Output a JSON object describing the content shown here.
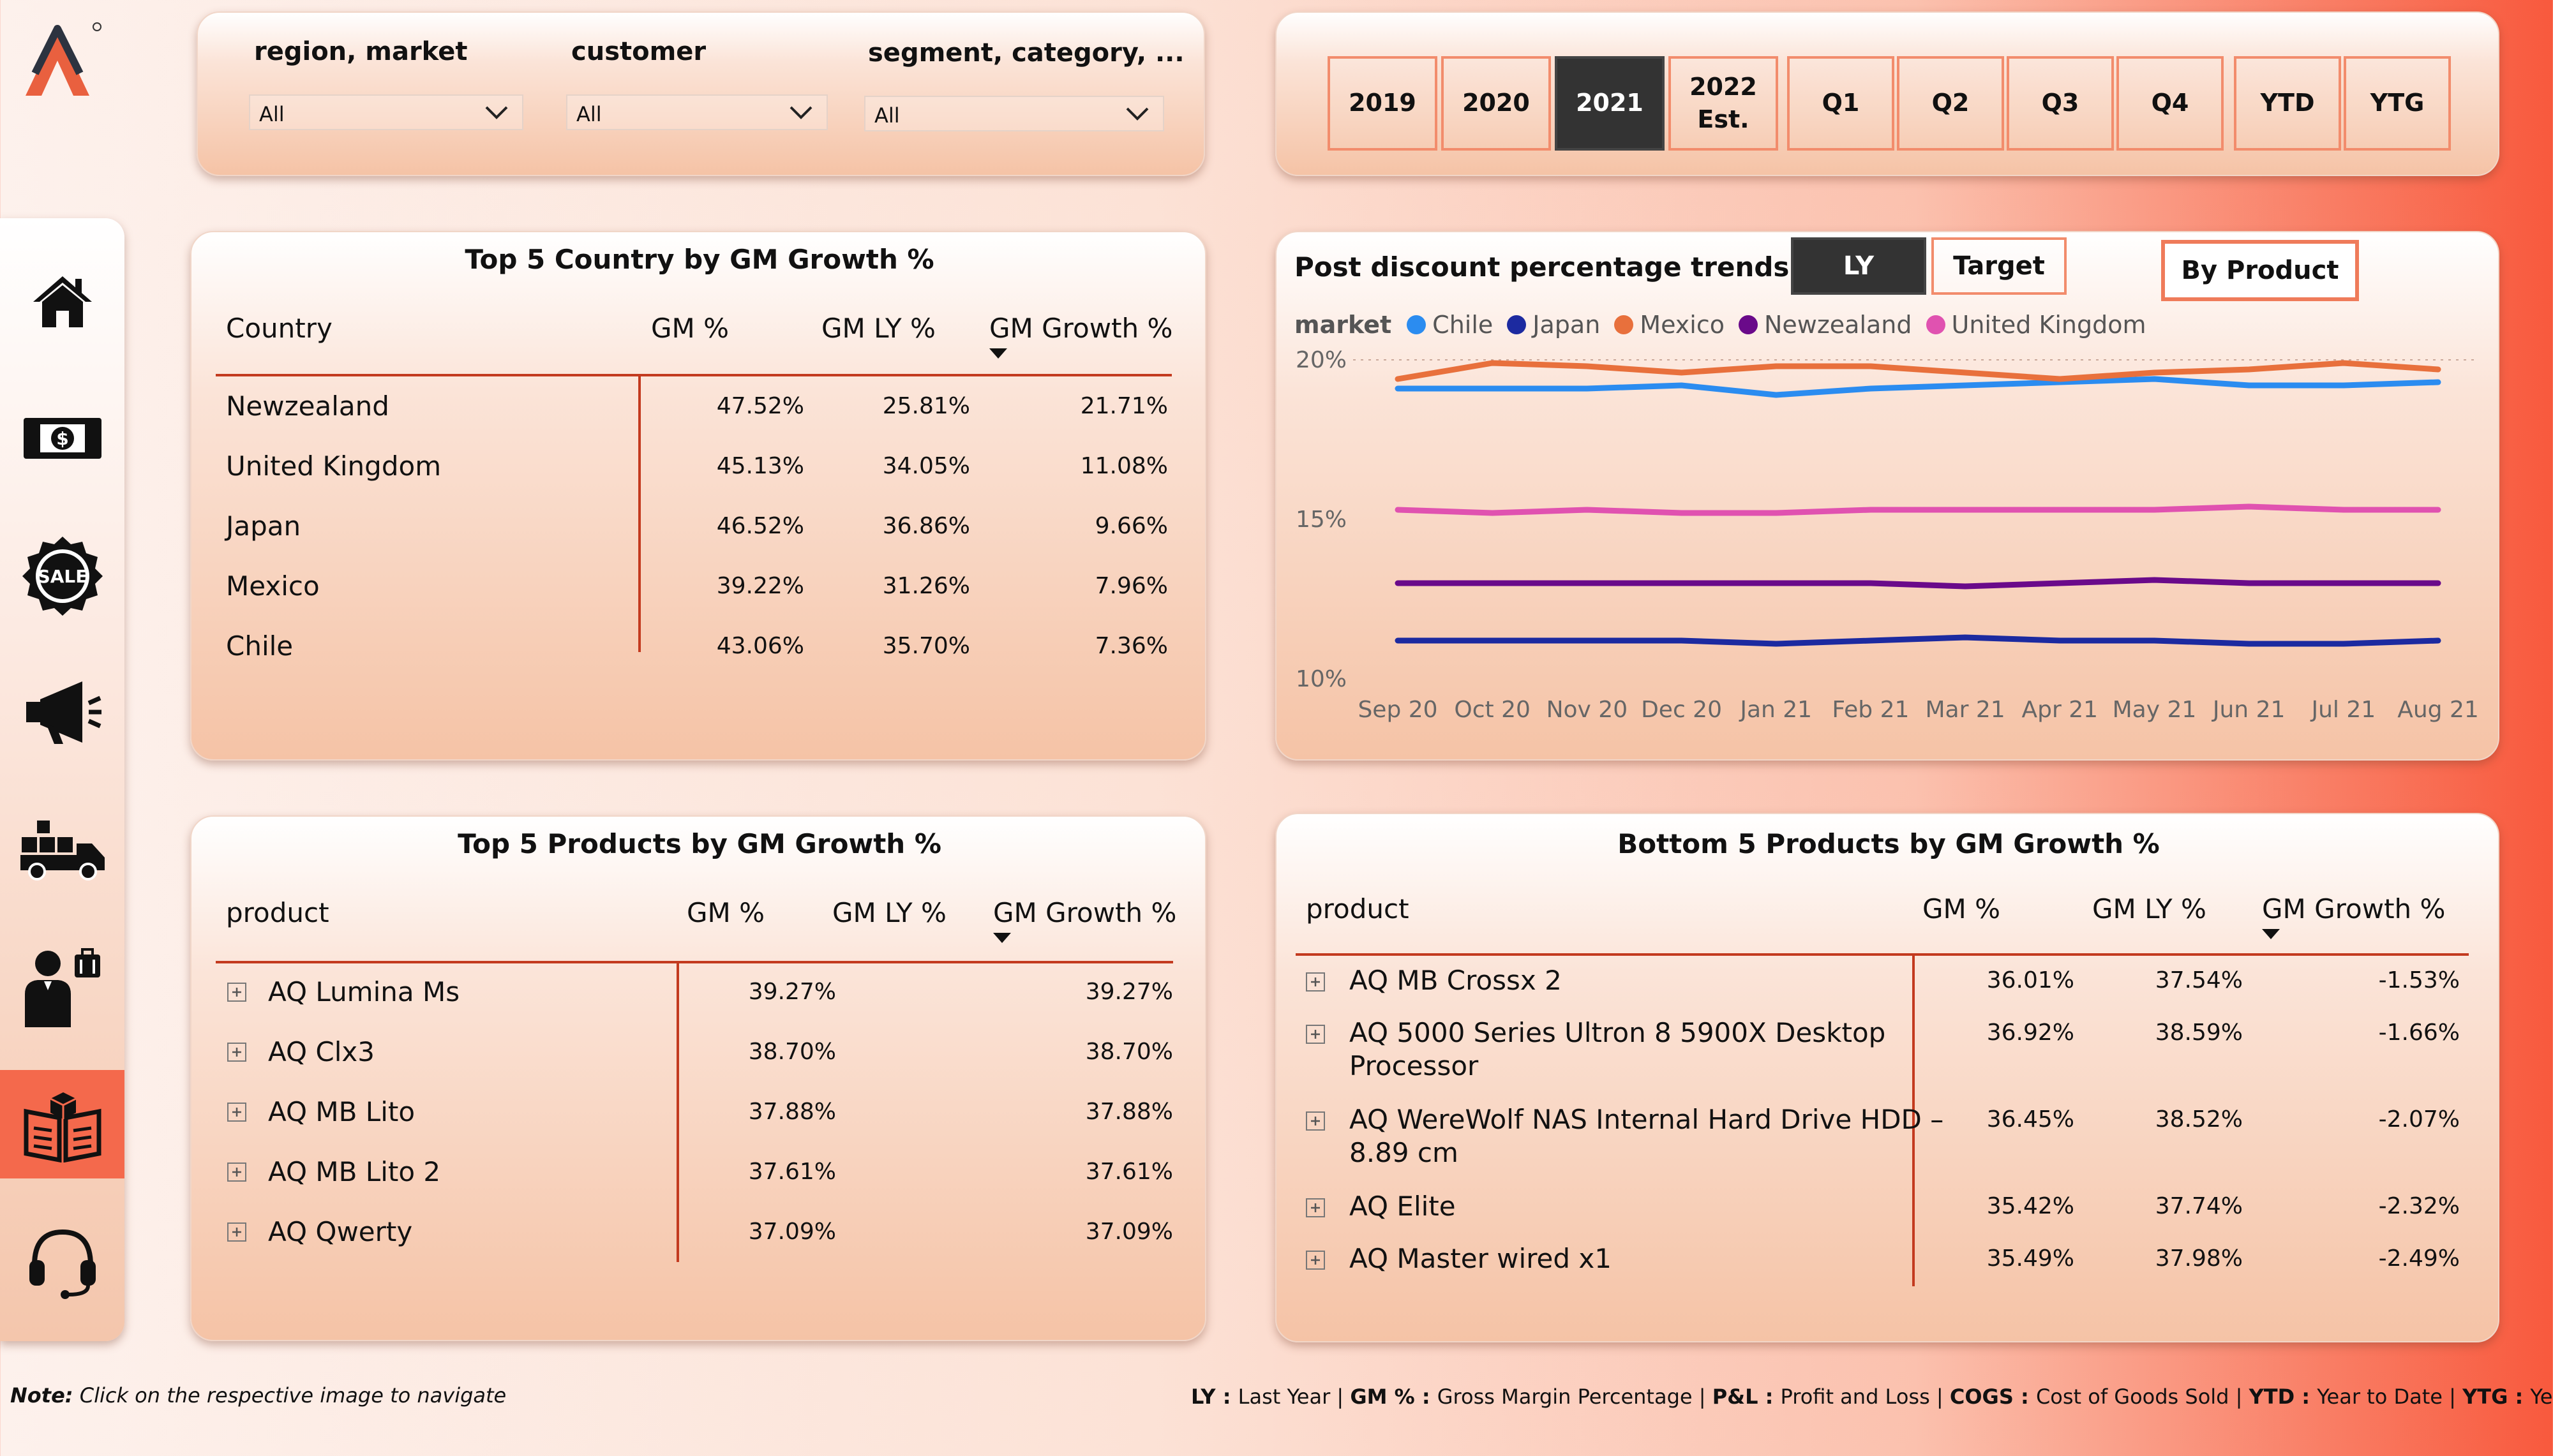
{
  "filters": [
    {
      "label": "region, market",
      "value": "All"
    },
    {
      "label": "customer",
      "value": "All"
    },
    {
      "label": "segment, category, ...",
      "value": "All"
    }
  ],
  "period_buttons": [
    {
      "label": "2019",
      "selected": false
    },
    {
      "label": "2020",
      "selected": false
    },
    {
      "label": "2021",
      "selected": true
    },
    {
      "label": "2022\nEst.",
      "selected": false
    },
    {
      "label": "Q1",
      "selected": false
    },
    {
      "label": "Q2",
      "selected": false
    },
    {
      "label": "Q3",
      "selected": false
    },
    {
      "label": "Q4",
      "selected": false
    },
    {
      "label": "YTD",
      "selected": false
    },
    {
      "label": "YTG",
      "selected": false
    }
  ],
  "nav_icons": [
    "home-icon",
    "money-icon",
    "sale-badge-icon",
    "megaphone-icon",
    "delivery-truck-icon",
    "businessman-icon",
    "product-catalog-icon",
    "headset-icon"
  ],
  "country_table": {
    "title": "Top 5 Country by GM Growth %",
    "headers": [
      "Country",
      "GM %",
      "GM LY %",
      "GM Growth %"
    ],
    "rows": [
      [
        "Newzealand",
        "47.52%",
        "25.81%",
        "21.71%"
      ],
      [
        "United Kingdom",
        "45.13%",
        "34.05%",
        "11.08%"
      ],
      [
        "Japan",
        "46.52%",
        "36.86%",
        "9.66%"
      ],
      [
        "Mexico",
        "39.22%",
        "31.26%",
        "7.96%"
      ],
      [
        "Chile",
        "43.06%",
        "35.70%",
        "7.36%"
      ]
    ]
  },
  "top_products": {
    "title": "Top 5 Products by GM Growth %",
    "headers": [
      "product",
      "GM %",
      "GM LY %",
      "GM Growth %"
    ],
    "rows": [
      [
        "AQ Lumina Ms",
        "39.27%",
        "",
        "39.27%"
      ],
      [
        "AQ Clx3",
        "38.70%",
        "",
        "38.70%"
      ],
      [
        "AQ MB Lito",
        "37.88%",
        "",
        "37.88%"
      ],
      [
        "AQ MB Lito 2",
        "37.61%",
        "",
        "37.61%"
      ],
      [
        "AQ Qwerty",
        "37.09%",
        "",
        "37.09%"
      ]
    ]
  },
  "bottom_products": {
    "title": "Bottom 5 Products by GM Growth %",
    "headers": [
      "product",
      "GM %",
      "GM LY %",
      "GM Growth %"
    ],
    "rows": [
      [
        "AQ MB Crossx 2",
        "",
        "36.01%",
        "37.54%",
        "-1.53%"
      ],
      [
        "AQ 5000 Series Ultron 8 5900X Desktop",
        "Processor",
        "36.92%",
        "38.59%",
        "-1.66%"
      ],
      [
        "AQ WereWolf NAS Internal Hard Drive HDD –",
        "8.89 cm",
        "36.45%",
        "38.52%",
        "-2.07%"
      ],
      [
        "AQ Elite",
        "",
        "35.42%",
        "37.74%",
        "-2.32%"
      ],
      [
        "AQ Master wired x1",
        "",
        "35.49%",
        "37.98%",
        "-2.49%"
      ]
    ]
  },
  "trend": {
    "title": "Post discount percentage trends",
    "toggle_ly": "LY",
    "toggle_target": "Target",
    "by_product": "By Product",
    "legend_title": "market"
  },
  "chart_data": {
    "type": "line",
    "categories": [
      "Sep 20",
      "Oct 20",
      "Nov 20",
      "Dec 20",
      "Jan 21",
      "Feb 21",
      "Mar 21",
      "Apr 21",
      "May 21",
      "Jun 21",
      "Jul 21",
      "Aug 21"
    ],
    "y_ticks": [
      "20%",
      "15%",
      "10%"
    ],
    "ylim": [
      10,
      20
    ],
    "series": [
      {
        "name": "Chile",
        "color": "#2b8cf0",
        "values": [
          19.1,
          19.1,
          19.1,
          19.2,
          18.9,
          19.1,
          19.2,
          19.3,
          19.4,
          19.2,
          19.2,
          19.3
        ]
      },
      {
        "name": "Japan",
        "color": "#1c2aa0",
        "values": [
          11.2,
          11.2,
          11.2,
          11.2,
          11.1,
          11.2,
          11.3,
          11.2,
          11.2,
          11.1,
          11.1,
          11.2
        ]
      },
      {
        "name": "Mexico",
        "color": "#e8703c",
        "values": [
          19.4,
          19.9,
          19.8,
          19.6,
          19.8,
          19.8,
          19.6,
          19.4,
          19.6,
          19.7,
          19.9,
          19.7
        ]
      },
      {
        "name": "Newzealand",
        "color": "#6a0a8a",
        "values": [
          13.0,
          13.0,
          13.0,
          13.0,
          13.0,
          13.0,
          12.9,
          13.0,
          13.1,
          13.0,
          13.0,
          13.0
        ]
      },
      {
        "name": "United Kingdom",
        "color": "#e052b0",
        "values": [
          15.3,
          15.2,
          15.3,
          15.2,
          15.2,
          15.3,
          15.3,
          15.3,
          15.3,
          15.4,
          15.3,
          15.3
        ]
      }
    ]
  },
  "footer": {
    "note_label": "Note:",
    "note_text": "Click on the respective image to navigate",
    "glossary": [
      {
        "term": "LY",
        "def": "Last Year"
      },
      {
        "term": "GM %",
        "def": "Gross Margin Percentage"
      },
      {
        "term": "P&L",
        "def": "Profit and Loss"
      },
      {
        "term": "COGS",
        "def": "Cost of Goods Sold"
      },
      {
        "term": "YTD",
        "def": "Year to Date"
      },
      {
        "term": "YTG",
        "def": "Year to Go"
      }
    ]
  }
}
